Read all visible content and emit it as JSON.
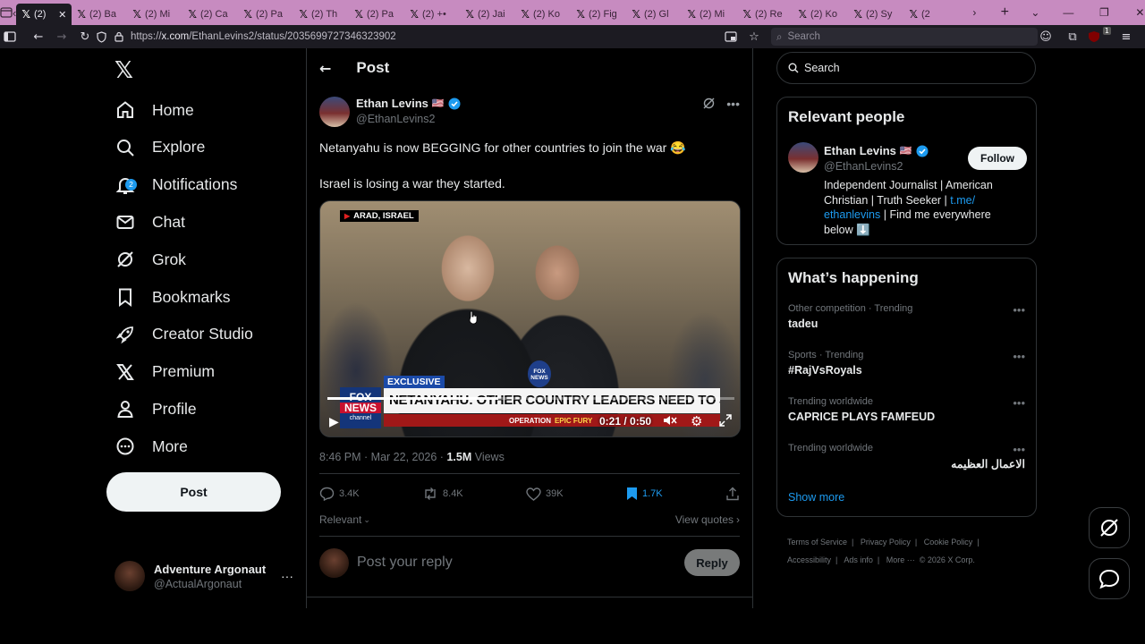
{
  "browser": {
    "tabs": [
      {
        "label": "(2)",
        "active": true
      },
      {
        "label": "(2) Ba"
      },
      {
        "label": "(2) Mi"
      },
      {
        "label": "(2) Ca"
      },
      {
        "label": "(2) Pa"
      },
      {
        "label": "(2) Th"
      },
      {
        "label": "(2) Pa"
      },
      {
        "label": "(2) +•"
      },
      {
        "label": "(2) Jai"
      },
      {
        "label": "(2) Ko"
      },
      {
        "label": "(2) Fig"
      },
      {
        "label": "(2) Gl"
      },
      {
        "label": "(2) Mi"
      },
      {
        "label": "(2) Re"
      },
      {
        "label": "(2) Ko"
      },
      {
        "label": "(2) Sy"
      },
      {
        "label": "(2"
      }
    ],
    "url_prefix": "https://",
    "url_domain": "x.com",
    "url_path": "/EthanLevins2/status/2035699727346323902",
    "search_placeholder": "Search",
    "extension_badge": "1"
  },
  "leftnav": {
    "items": [
      {
        "label": "Home",
        "icon": "home-icon"
      },
      {
        "label": "Explore",
        "icon": "search-icon"
      },
      {
        "label": "Notifications",
        "icon": "bell-icon",
        "badge": "2"
      },
      {
        "label": "Chat",
        "icon": "mail-icon"
      },
      {
        "label": "Grok",
        "icon": "grok-icon"
      },
      {
        "label": "Bookmarks",
        "icon": "bookmark-icon"
      },
      {
        "label": "Creator Studio",
        "icon": "rocket-icon"
      },
      {
        "label": "Premium",
        "icon": "x-logo-icon"
      },
      {
        "label": "Profile",
        "icon": "person-icon"
      },
      {
        "label": "More",
        "icon": "more-circle-icon"
      }
    ],
    "post_button": "Post",
    "account": {
      "name": "Adventure Argonaut",
      "handle": "@ActualArgonaut",
      "menu": "···"
    }
  },
  "post": {
    "header_title": "Post",
    "author_name": "Ethan Levins",
    "author_flag": "🇺🇸",
    "author_handle": "@EthanLevins2",
    "text_line1": "Netanyahu is now BEGGING for other countries to join the war 😂",
    "text_line2": "Israel is losing a war they started.",
    "video": {
      "location_tag": "ARAD, ISRAEL",
      "exclusive_tag": "EXCLUSIVE",
      "headline": "NETANYAHU: OTHER COUNTRY LEADERS NEED TO JOIN US",
      "network_line1": "FOX",
      "network_line2": "NEWS",
      "network_line3": "channel",
      "operation_left": "OPERATION",
      "operation_right": "EPIC FURY",
      "time": "0:21 / 0:50",
      "progress": 0.42
    },
    "timestamp": "8:46 PM · Mar 22, 2026 · ",
    "views_count": "1.5M",
    "views_label": "Views",
    "replies": "3.4K",
    "reposts": "8.4K",
    "likes": "39K",
    "bookmarks": "1.7K",
    "sort_label": "Relevant",
    "view_quotes": "View quotes",
    "reply_placeholder": "Post your reply",
    "reply_button": "Reply"
  },
  "right": {
    "search_placeholder": "Search",
    "relevant_title": "Relevant people",
    "person": {
      "name": "Ethan Levins",
      "flag": "🇺🇸",
      "handle": "@EthanLevins2",
      "follow": "Follow",
      "bio_pre": "Independent Journalist | American Christian | Truth Seeker | ",
      "bio_link": "t.me/ ethanlevins",
      "bio_post": " | Find me everywhere below ⬇️"
    },
    "happening_title": "What’s happening",
    "trends": [
      {
        "category": "Other competition · Trending",
        "name": "tadeu"
      },
      {
        "category": "Sports · Trending",
        "name": "#RajVsRoyals"
      },
      {
        "category": "Trending worldwide",
        "name": "CAPRICE PLAYS FAMFEUD"
      },
      {
        "category": "Trending worldwide",
        "name": "الاعمال العظيمه"
      }
    ],
    "show_more": "Show more",
    "footer": {
      "terms": "Terms of Service",
      "privacy": "Privacy Policy",
      "cookie": "Cookie Policy",
      "accessibility": "Accessibility",
      "ads": "Ads info",
      "more": "More ···",
      "copyright": "© 2026 X Corp."
    }
  },
  "colors": {
    "accent": "#1d9bf0",
    "tabbar": "#c78bc0",
    "background": "#000000"
  }
}
